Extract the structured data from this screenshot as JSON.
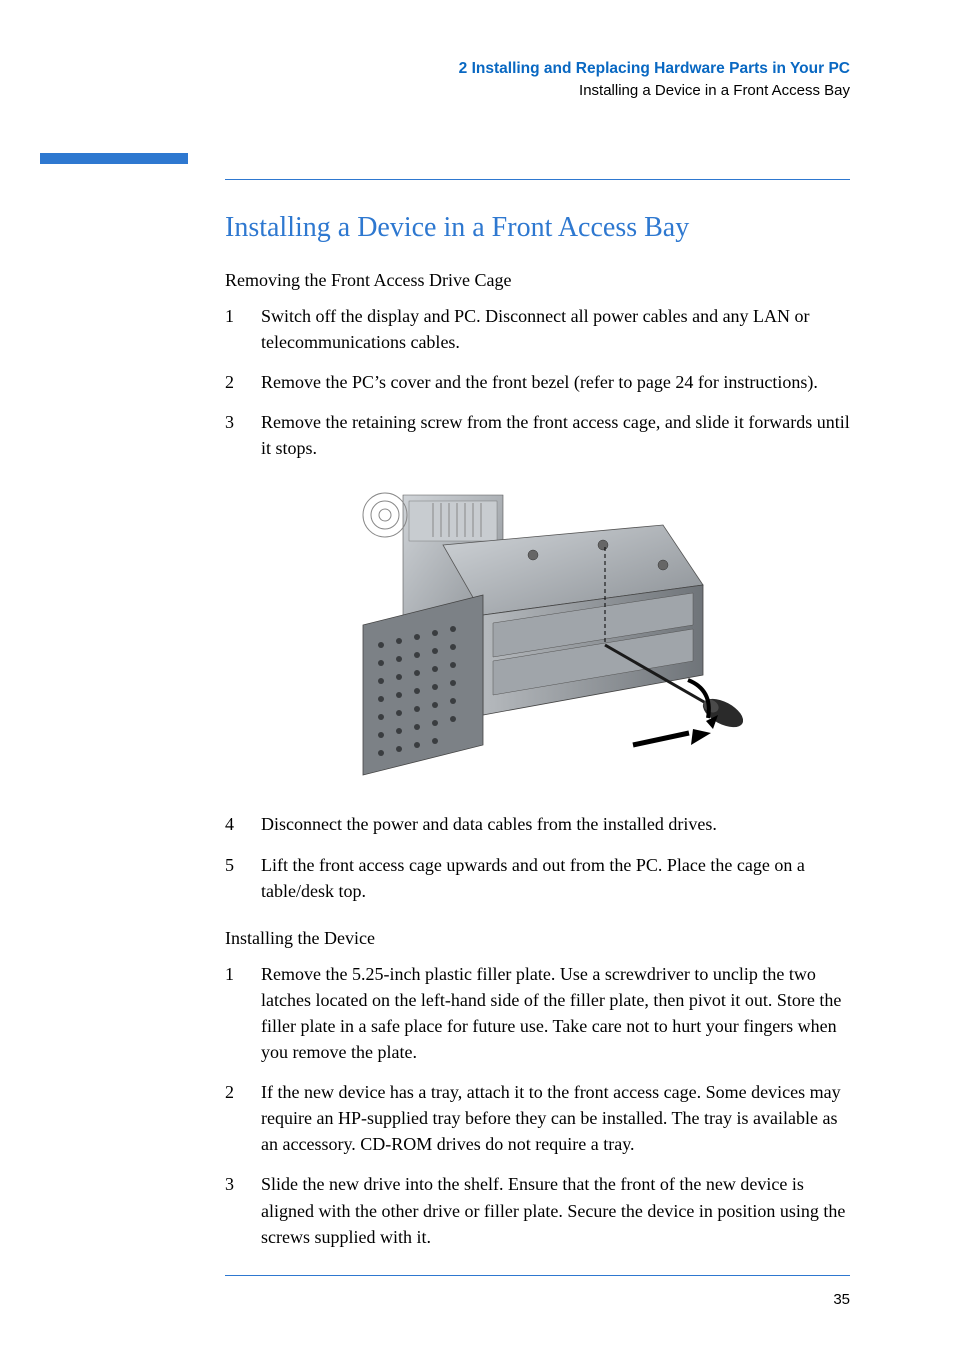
{
  "header": {
    "chapter": "2   Installing and Replacing Hardware Parts in Your PC",
    "section": "Installing a Device in a Front Access Bay"
  },
  "title": "Installing a Device in a Front Access Bay",
  "section1": {
    "heading": "Removing the Front Access Drive Cage",
    "steps": [
      "Switch off the display and PC. Disconnect all power cables and any LAN or telecommunications cables.",
      "Remove the PC’s cover and the front bezel (refer to page 24 for instructions).",
      "Remove the retaining screw from the front access cage, and slide it forwards until it stops.",
      "Disconnect the power and data cables from the installed drives.",
      "Lift the front access cage upwards and out from the PC. Place the cage on a table/desk top."
    ]
  },
  "section2": {
    "heading": "Installing the Device",
    "steps": [
      "Remove the 5.25-inch plastic filler plate. Use a screwdriver to unclip the two latches located on the left-hand side of the filler plate, then pivot it out. Store the filler plate in a safe place for future use. Take care not to hurt your fingers when you remove the plate.",
      "If the new device has a tray, attach it to the front access cage. Some devices may require an HP-supplied tray before they can be installed. The tray is available as an accessory. CD-ROM drives do not require a tray.",
      "Slide the new drive into the shelf. Ensure that the front of the new device is aligned with the other drive or filler plate. Secure the device in position using the screws supplied with it."
    ]
  },
  "page_number": "35"
}
